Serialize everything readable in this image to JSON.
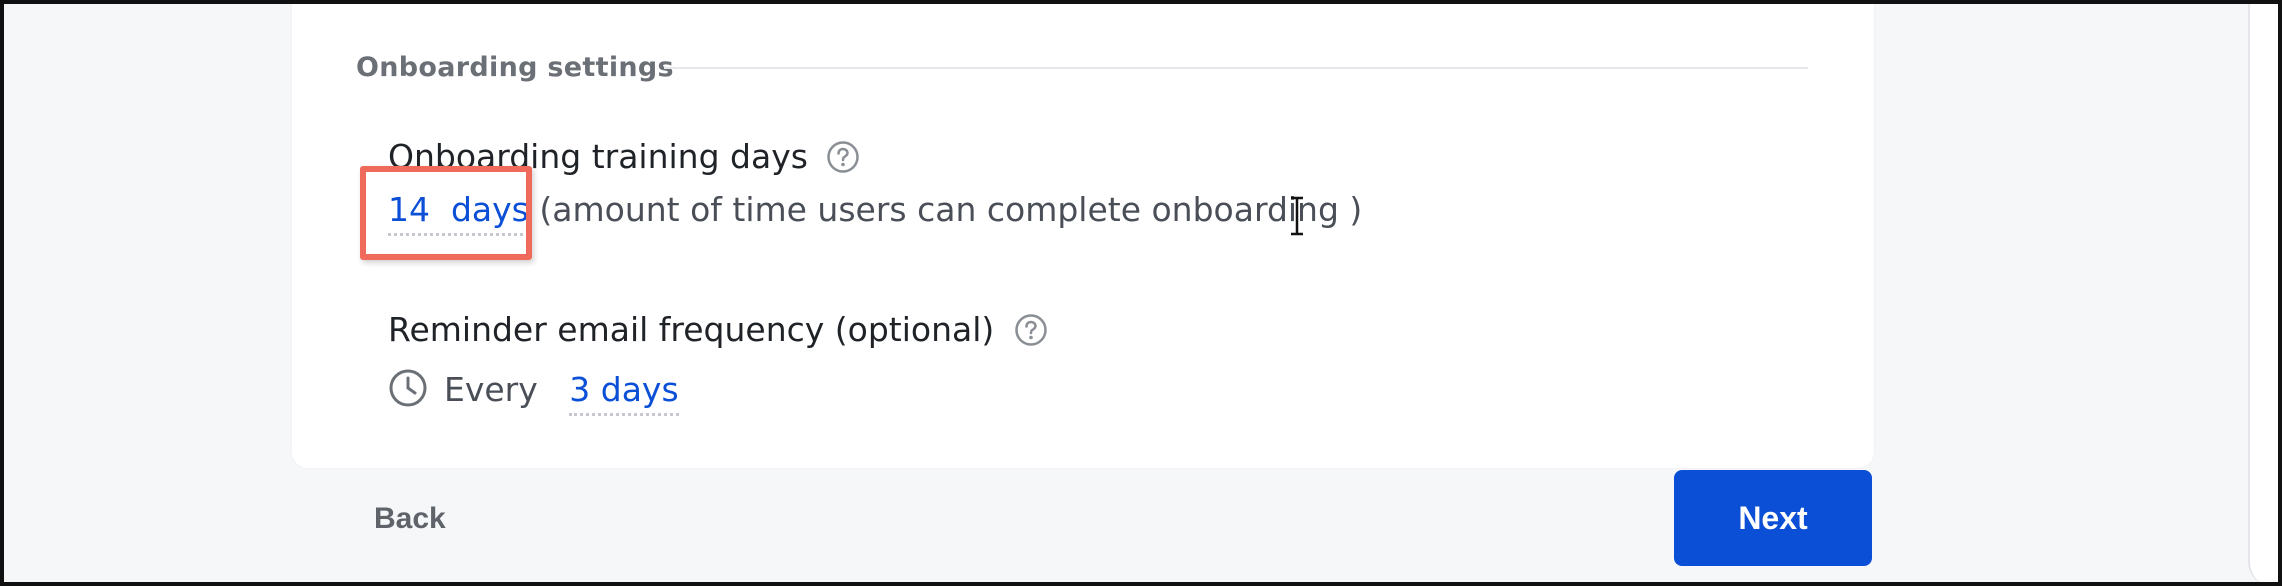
{
  "section": {
    "title": "Onboarding settings"
  },
  "training": {
    "label": "Onboarding training days",
    "help_icon": "question-circle-icon",
    "value": "14",
    "unit": "days",
    "description": "(amount of time users can complete onboarding )"
  },
  "reminder": {
    "label": "Reminder email frequency (optional)",
    "help_icon": "question-circle-icon",
    "icon": "clock-icon",
    "prefix": "Every",
    "value": "3 days"
  },
  "footer": {
    "back_label": "Back",
    "next_label": "Next"
  },
  "colors": {
    "accent": "#0a4fd6",
    "highlight": "#ef6a5b",
    "text": "#1f2328",
    "muted": "#6b6f76"
  }
}
